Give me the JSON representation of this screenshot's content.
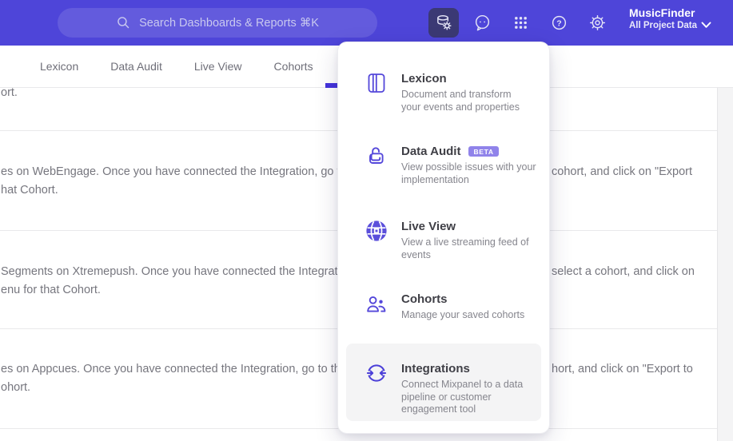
{
  "topbar": {
    "search_placeholder": "Search Dashboards & Reports ⌘K",
    "project_name": "MusicFinder",
    "project_subtitle": "All Project Data",
    "icons": [
      "data-management",
      "feedback",
      "apps-grid",
      "help",
      "settings"
    ],
    "active_icon": "data-management"
  },
  "nav": {
    "tabs": [
      {
        "label": "Lexicon"
      },
      {
        "label": "Data Audit"
      },
      {
        "label": "Live View"
      },
      {
        "label": "Cohorts"
      }
    ]
  },
  "menu": {
    "items": [
      {
        "title": "Lexicon",
        "icon": "journal-icon",
        "desc": [
          "Document and transform",
          "your events and properties"
        ]
      },
      {
        "title": "Data Audit",
        "icon": "lock-audit-icon",
        "badge": "BETA",
        "desc": [
          "View possible issues with your",
          "implementation"
        ]
      },
      {
        "title": "Live View",
        "icon": "globe-icon",
        "desc": [
          "View a live streaming feed of",
          "events"
        ]
      },
      {
        "title": "Cohorts",
        "icon": "cohorts-people-icon",
        "desc": [
          "Manage your saved cohorts"
        ]
      },
      {
        "title": "Integrations",
        "icon": "integrations-sync-icon",
        "highlighted": true,
        "desc": [
          "Connect Mixpanel to a data",
          "pipeline or customer",
          "engagement tool"
        ]
      }
    ]
  },
  "content": {
    "fragment_top": "ort.",
    "rows": [
      {
        "left_line1": "es on WebEngage. Once you have connected the Integration, go to the",
        "right_line1": "cohort, and click on \"Export",
        "left_line2": "hat Cohort."
      },
      {
        "left_line1": "Segments on Xtremepush. Once you have connected the Integration, ",
        "right_line1": "select a cohort, and click on",
        "left_line2": "enu for that Cohort."
      },
      {
        "left_line1": "es on Appcues. Once you have connected the Integration, go to the M",
        "right_line1": "hort, and click on \"Export to",
        "left_line2": "ohort."
      }
    ]
  },
  "colors": {
    "topbar": "#4E45D9",
    "active_icon_bg": "#3B3974",
    "accent": "#5447DA",
    "tab_indicator": "#4433DB",
    "badge": "#9083EA",
    "highlight_row": "#F4F4F5",
    "body_text": "#76767E"
  }
}
